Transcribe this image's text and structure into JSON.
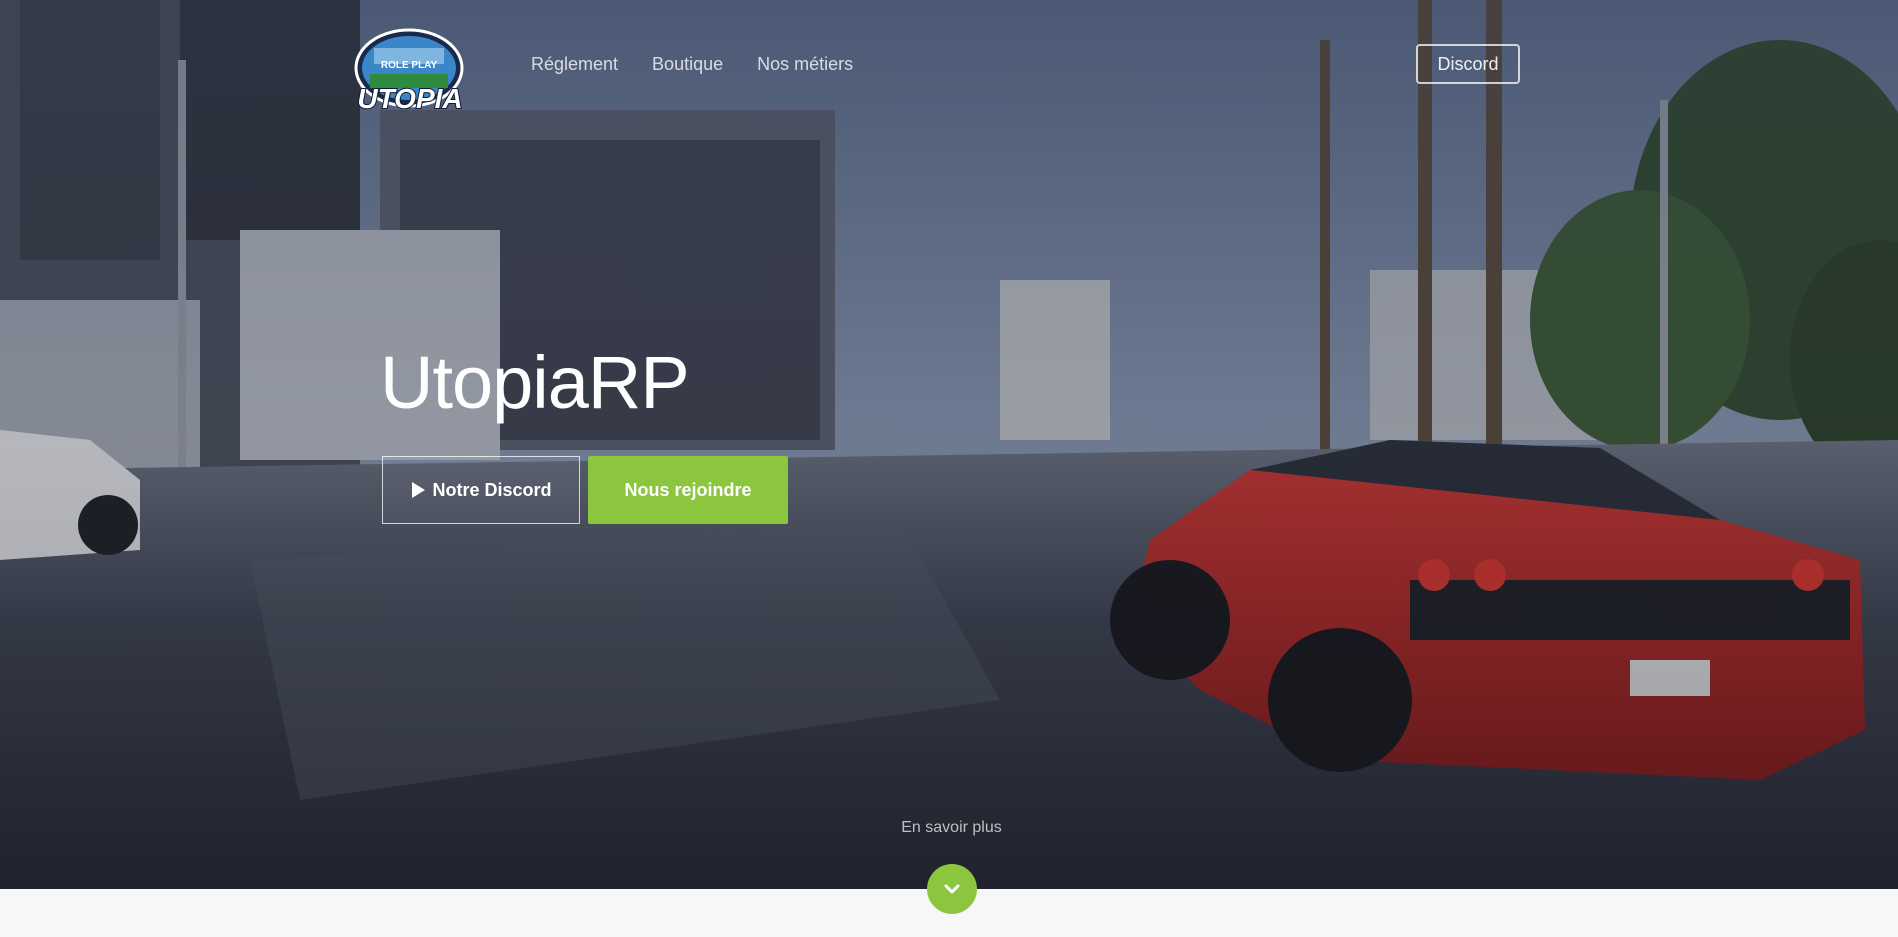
{
  "nav": {
    "items": [
      {
        "label": "Réglement"
      },
      {
        "label": "Boutique"
      },
      {
        "label": "Nos métiers"
      }
    ],
    "discord_label": "Discord"
  },
  "logo": {
    "top_text": "ROLE PLAY",
    "main_text": "UTOPIA",
    "icon": "utopia-logo-icon"
  },
  "hero": {
    "title": "UtopiaRP",
    "primary_button": "Notre Discord",
    "primary_icon": "play-icon",
    "secondary_button": "Nous rejoindre",
    "learn_more": "En savoir plus",
    "scroll_icon": "chevron-down-icon"
  },
  "colors": {
    "accent": "#8cc63f",
    "overlay": "#2b3146"
  }
}
